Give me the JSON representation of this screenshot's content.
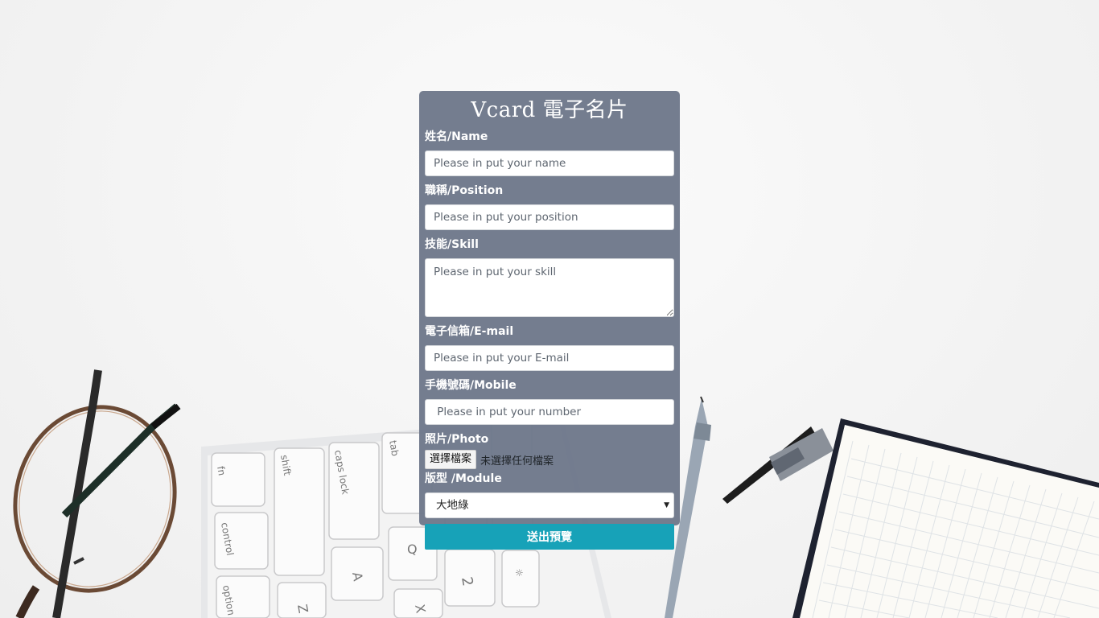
{
  "card": {
    "title": "Vcard 電子名片"
  },
  "form": {
    "name": {
      "label": "姓名/Name",
      "placeholder": "Please in put your name"
    },
    "position": {
      "label": "職稱/Position",
      "placeholder": "Please in put your position"
    },
    "skill": {
      "label": "技能/Skill",
      "placeholder": "Please in put your skill"
    },
    "email": {
      "label": "電子信箱/E-mail",
      "placeholder": "Please in put your E-mail"
    },
    "mobile": {
      "label": "手機號碼/Mobile",
      "placeholder": " Please in put your number"
    },
    "photo": {
      "label": "照片/Photo",
      "button_label": "選擇檔案",
      "status": "未選擇任何檔案"
    },
    "module": {
      "label": "版型 /Module",
      "selected": "大地綠"
    },
    "submit_label": "送出預覽"
  },
  "colors": {
    "card_background": "#6e788a",
    "submit_button": "#17a2b8"
  },
  "icons": {
    "select_arrow": "caret-down-icon"
  }
}
